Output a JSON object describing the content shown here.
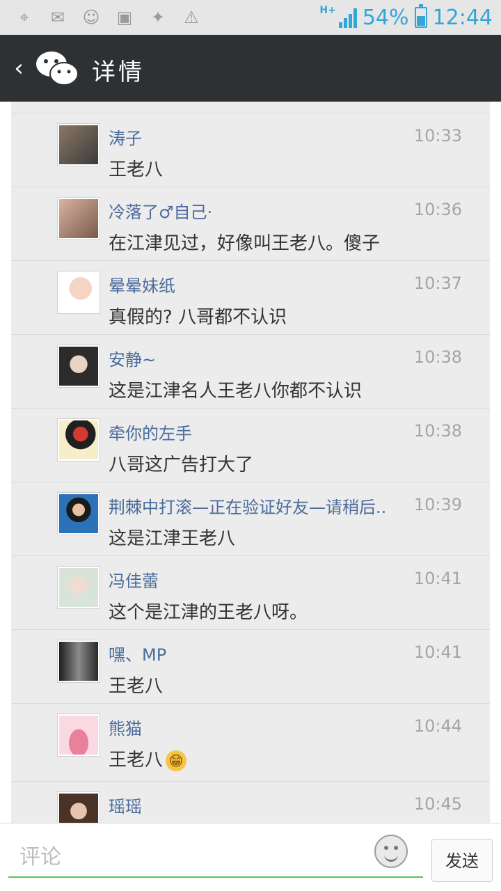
{
  "status_bar": {
    "left_icons": [
      "location-icon",
      "wechat-mail-icon",
      "wechat-icon",
      "image-icon",
      "app-warning-icon",
      "warning-icon"
    ],
    "network": "H+",
    "battery": "54%",
    "time": "12:44"
  },
  "header": {
    "back_icon": "chevron-left-icon",
    "logo": "wechat-logo",
    "title": "详情"
  },
  "comments": [
    {
      "name": "涛子",
      "time": "10:33",
      "text": "王老八",
      "avatar_color": "#6b6b6b"
    },
    {
      "name": "冷落了♂自己·",
      "time": "10:36",
      "text": "在江津见过，好像叫王老八。傻子",
      "avatar_color": "#c9a089"
    },
    {
      "name": "晕晕妹纸",
      "time": "10:37",
      "text": "真假的? 八哥都不认识",
      "avatar_color": "#f1d6c6"
    },
    {
      "name": "安静~",
      "time": "10:38",
      "text": "这是江津名人王老八你都不认识",
      "avatar_color": "#3c3c3c"
    },
    {
      "name": "牵你的左手",
      "time": "10:38",
      "text": "八哥这广告打大了",
      "avatar_color": "#d23b2d"
    },
    {
      "name": "荆棘中打滚—正在验证好友—请稍后..",
      "time": "10:39",
      "text": "这是江津王老八",
      "avatar_color": "#2b72b8"
    },
    {
      "name": "冯佳蕾",
      "time": "10:41",
      "text": "这个是江津的王老八呀。",
      "avatar_color": "#d9cfc5"
    },
    {
      "name": "嘿、MP",
      "time": "10:41",
      "text": "王老八",
      "avatar_color": "#4a4a4a"
    },
    {
      "name": "熊猫",
      "time": "10:44",
      "text": "王老八",
      "emoji": "😁",
      "avatar_color": "#f3a3b7"
    },
    {
      "name": "瑶瑶",
      "time": "10:45",
      "text": "",
      "avatar_color": "#7d5a46"
    }
  ],
  "input_bar": {
    "placeholder": "评论",
    "emoji_icon": "smiley-icon",
    "send_label": "发送"
  }
}
